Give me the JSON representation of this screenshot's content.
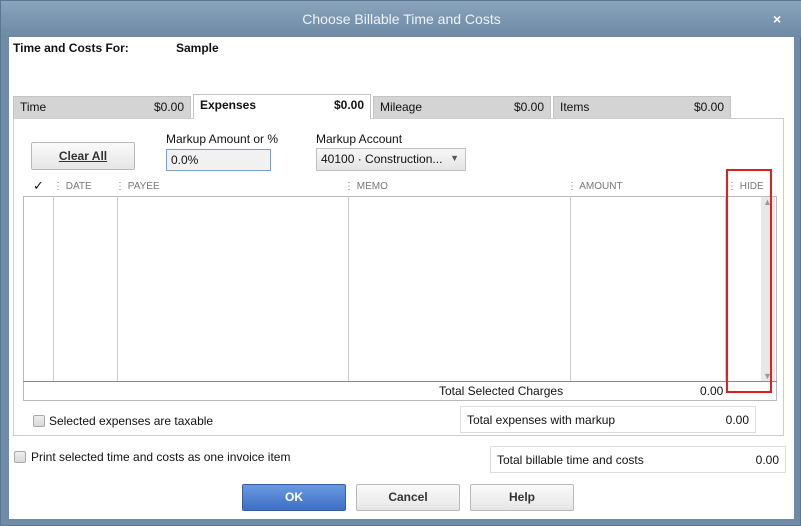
{
  "window": {
    "title": "Choose Billable Time and Costs",
    "close": "×"
  },
  "header": {
    "label": "Time and Costs For:",
    "customer": "Sample"
  },
  "tabs": [
    {
      "label": "Time",
      "amount": "$0.00"
    },
    {
      "label": "Expenses",
      "amount": "$0.00"
    },
    {
      "label": "Mileage",
      "amount": "$0.00"
    },
    {
      "label": "Items",
      "amount": "$0.00"
    }
  ],
  "clear_all": "Clear All",
  "markup_amount": {
    "label": "Markup Amount or %",
    "value": "0.0%"
  },
  "markup_account": {
    "label": "Markup Account",
    "value": "40100 · Construction..."
  },
  "columns": [
    "✓",
    "DATE",
    "PAYEE",
    "MEMO",
    "AMOUNT",
    "HIDE"
  ],
  "total_selected": {
    "label": "Total Selected Charges",
    "value": "0.00"
  },
  "taxable": {
    "label": "Selected expenses are taxable",
    "checked": false
  },
  "total_markup": {
    "label": "Total expenses with markup",
    "value": "0.00"
  },
  "print_one": {
    "label": "Print selected time and costs as one invoice item",
    "checked": false
  },
  "total_billable": {
    "label": "Total billable time and costs",
    "value": "0.00"
  },
  "buttons": {
    "ok": "OK",
    "cancel": "Cancel",
    "help": "Help"
  },
  "highlight_color": "#e02020"
}
